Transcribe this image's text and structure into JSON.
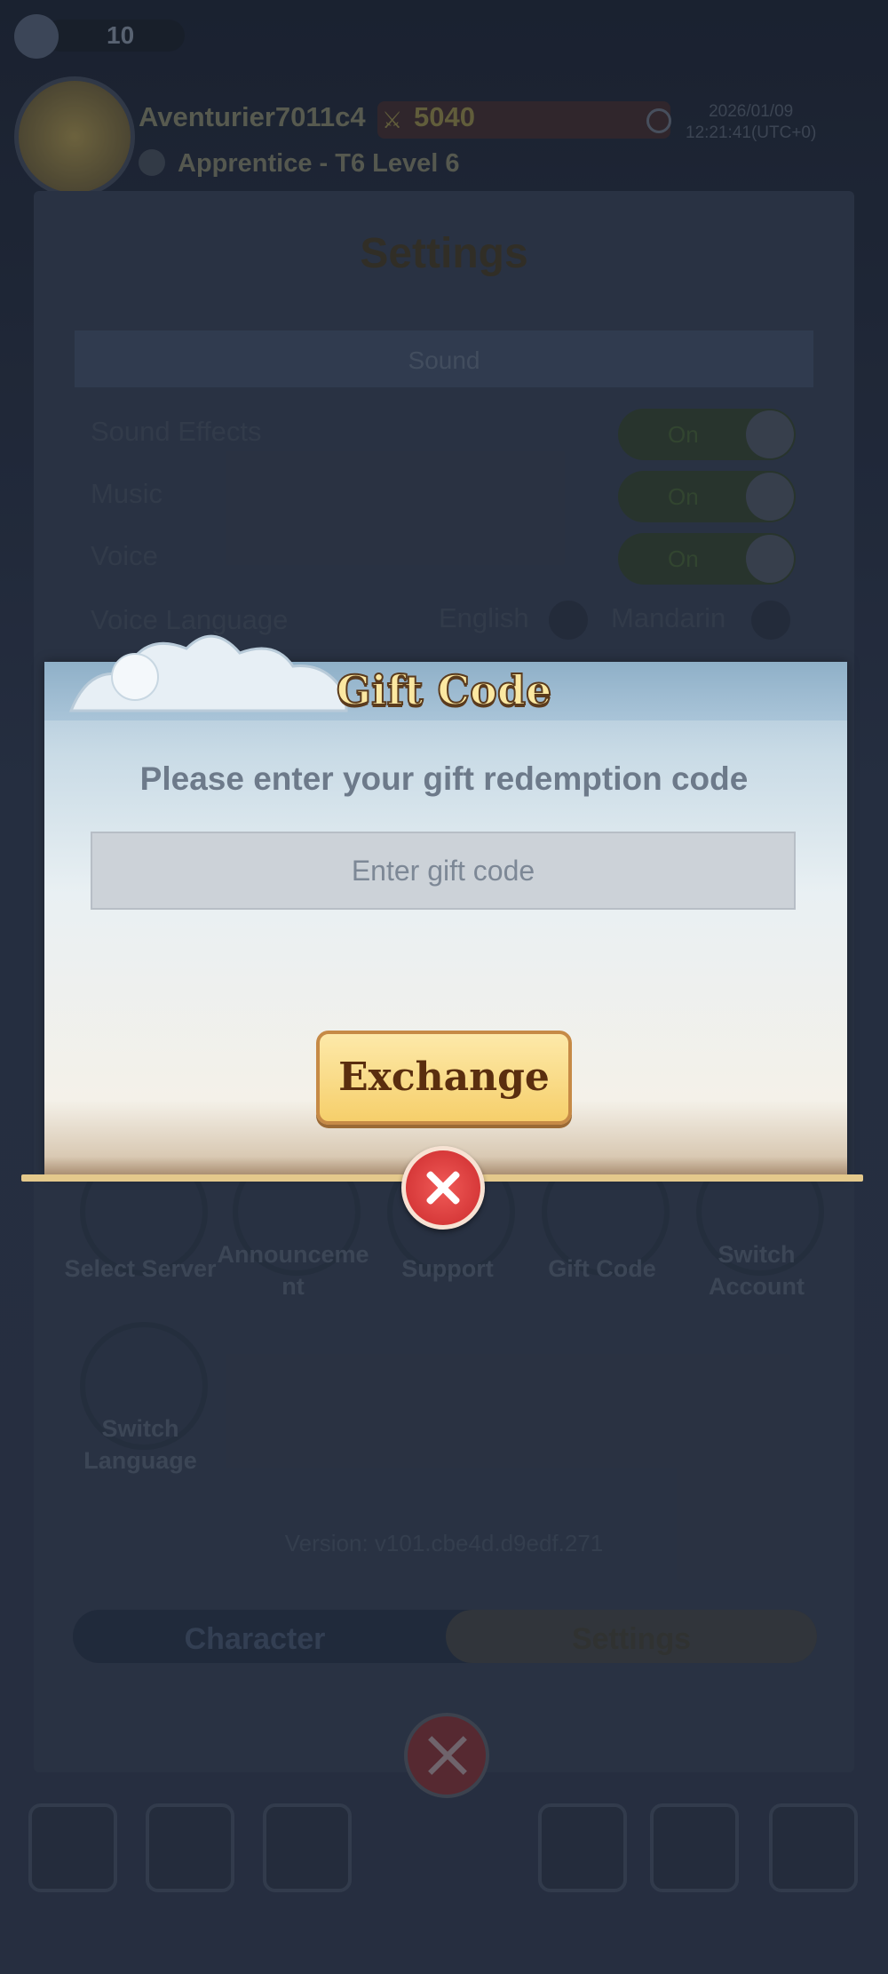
{
  "header": {
    "currency_value": "10",
    "username": "Aventurier7011c4",
    "power_value": "5040",
    "date": "2026/01/09",
    "time": "12:21:41(UTC+0)",
    "rank": "Apprentice - T6 Level 6"
  },
  "settings": {
    "title": "Settings",
    "sound_section": "Sound",
    "rows": [
      {
        "label": "Sound Effects",
        "state": "On"
      },
      {
        "label": "Music",
        "state": "On"
      },
      {
        "label": "Voice",
        "state": "On"
      }
    ],
    "voice_language_label": "Voice Language",
    "voice_language_options": [
      "English",
      "Mandarin"
    ],
    "selected_voice_language": "Mandarin",
    "buttons": [
      "Select Server",
      "Announceme nt",
      "Support",
      "Gift Code",
      "Switch Account",
      "Switch Language"
    ],
    "version": "Version: v101.cbe4d.d9edf.271",
    "tabs": [
      "Character",
      "Settings"
    ],
    "active_tab": "Settings"
  },
  "dialog": {
    "title": "Gift Code",
    "prompt": "Please enter your gift redemption code",
    "input_placeholder": "Enter gift code",
    "input_value": "",
    "exchange_label": "Exchange"
  },
  "colors": {
    "accent_gold": "#f6cf6b",
    "close_red": "#e04343",
    "dialog_blue": "#a6c1d6"
  }
}
